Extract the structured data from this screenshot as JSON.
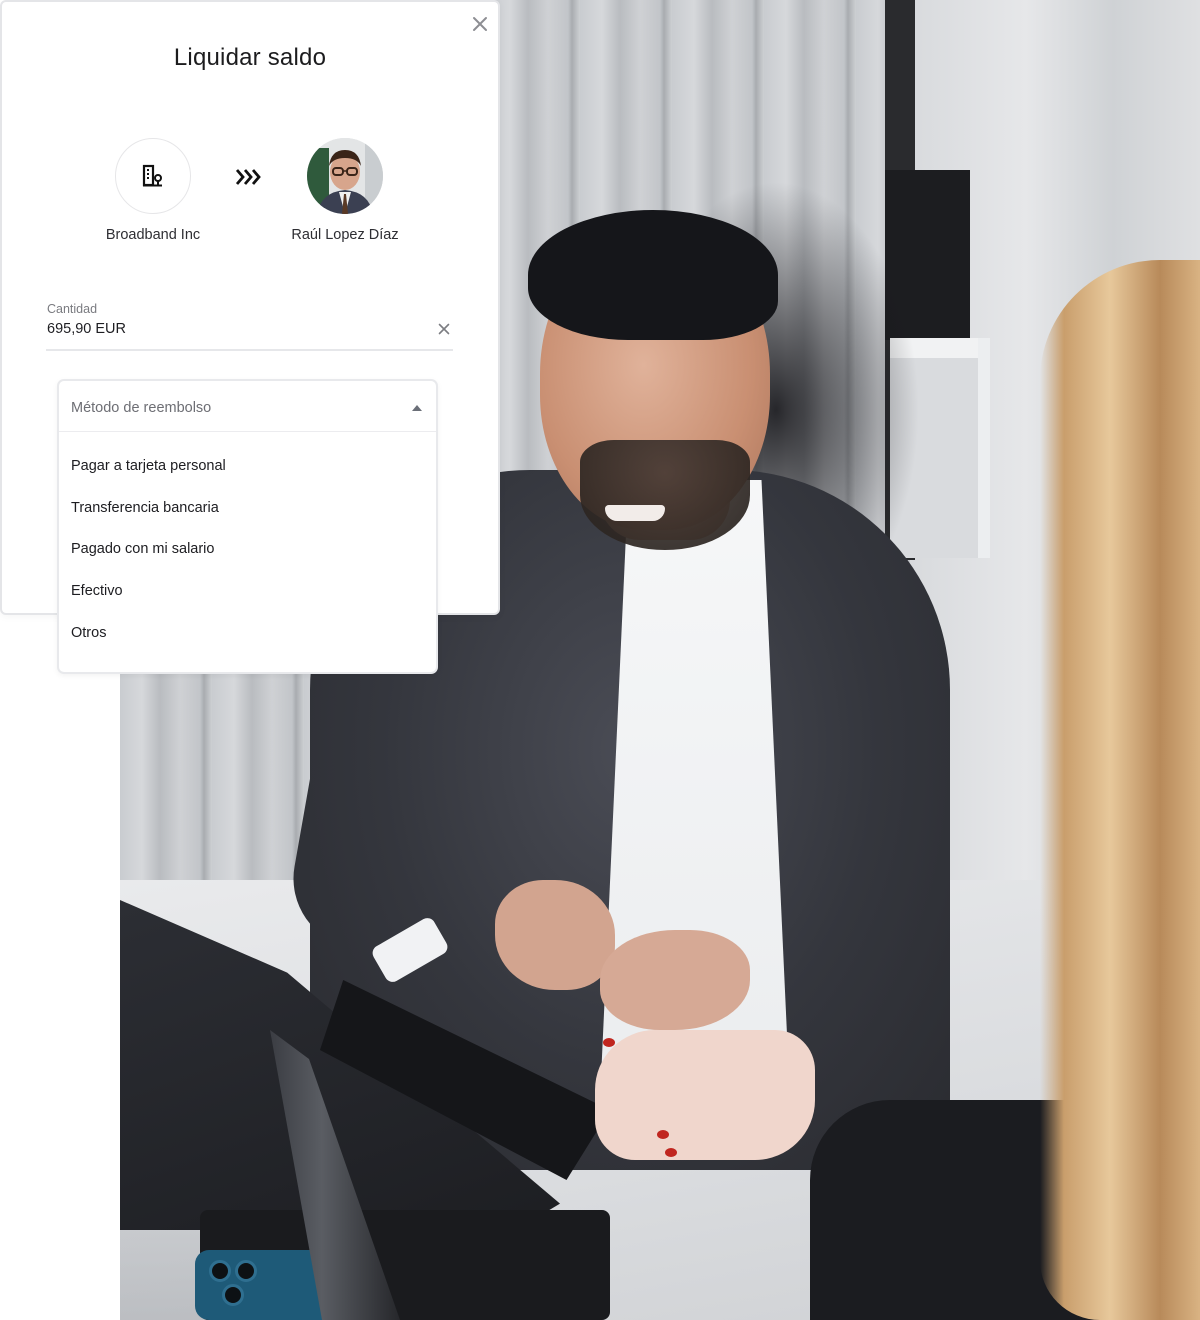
{
  "modal": {
    "title": "Liquidar saldo",
    "close_icon": "close-icon"
  },
  "transfer": {
    "from": {
      "name": "Broadband Inc",
      "icon": "building-icon"
    },
    "direction_icon": "triple-chevron-right-icon",
    "to": {
      "name": "Raúl Lopez Díaz",
      "icon": "avatar"
    }
  },
  "amount_field": {
    "label": "Cantidad",
    "value": "695,90 EUR",
    "clear_icon": "clear-icon"
  },
  "reimbursement_dropdown": {
    "placeholder": "Método de reembolso",
    "expanded": true,
    "caret_icon": "caret-up-icon",
    "options": [
      "Pagar a tarjeta personal",
      "Transferencia bancaria",
      "Pagado con mi salario",
      "Efectivo",
      "Otros"
    ]
  },
  "background_photo": {
    "description": "Man in dark suit and white shirt seated at desk with laptops, woman with long blonde hair in foreground right"
  }
}
